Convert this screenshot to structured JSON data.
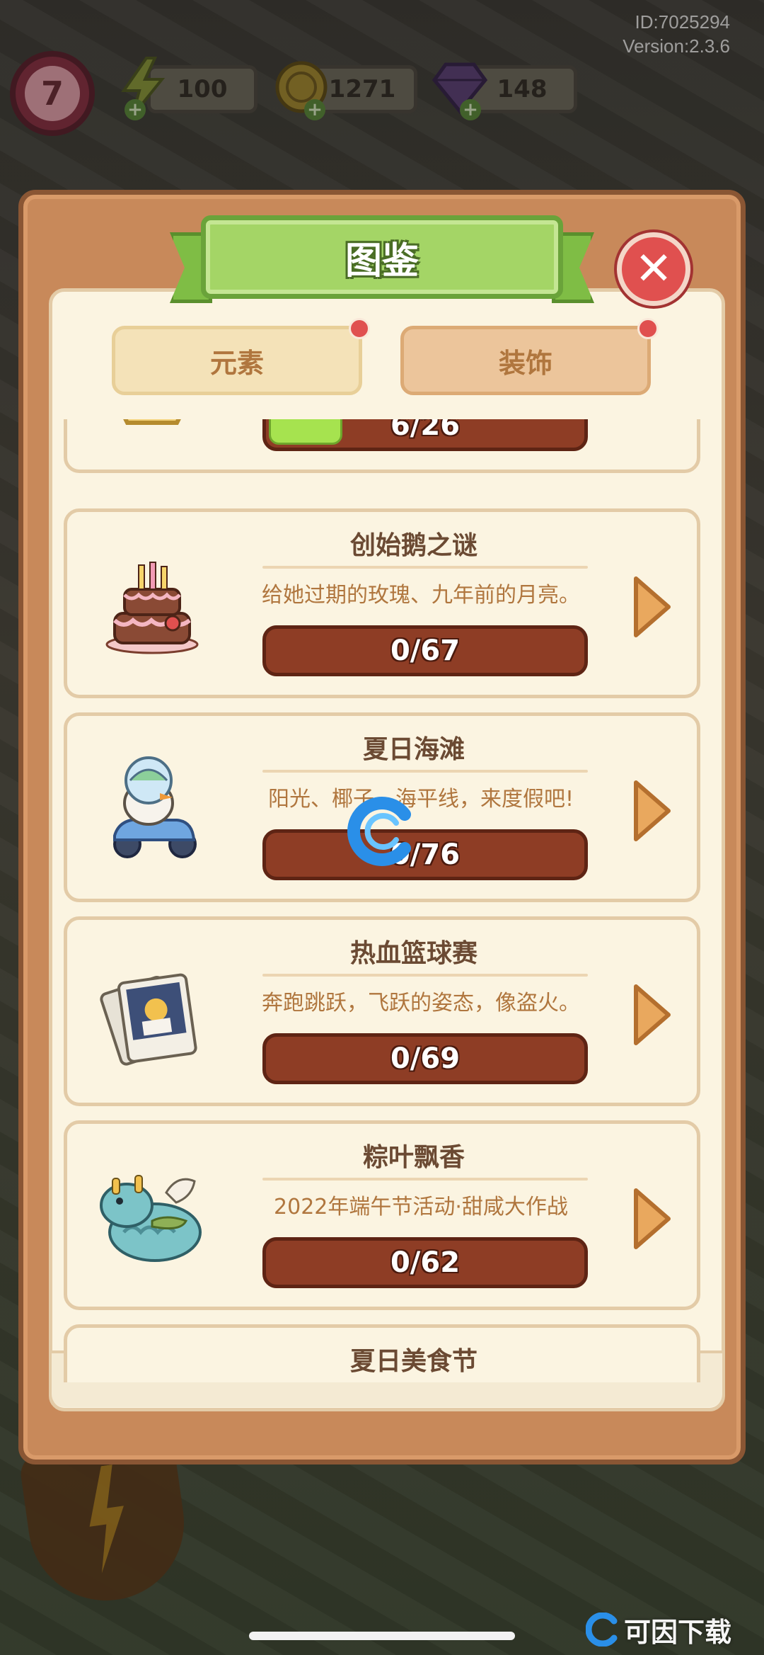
{
  "hud": {
    "id_text": "ID:7025294",
    "version_text": "Version:2.3.6",
    "level": "7",
    "energy": "100",
    "coins": "1271",
    "gems": "148"
  },
  "colors": {
    "panel_wood": "#c8895a",
    "ribbon_green": "#a4d566",
    "close_red": "#e0504f",
    "bar_brown": "#8e3d25",
    "progress_green": "#a6e34f"
  },
  "dialog": {
    "title": "图鉴",
    "close_icon": "close-icon",
    "tabs": [
      {
        "label": "元素",
        "has_notification": true
      },
      {
        "label": "装饰",
        "has_notification": true
      }
    ]
  },
  "collections": [
    {
      "title": "",
      "description": "",
      "progress_text": "6/26",
      "progress": 0.23,
      "icon": "hexagon-tile-icon"
    },
    {
      "title": "创始鹅之谜",
      "description": "给她过期的玫瑰、九年前的月亮。",
      "progress_text": "0/67",
      "progress": 0,
      "icon": "birthday-cake-icon"
    },
    {
      "title": "夏日海滩",
      "description": "阳光、椰子、海平线，来度假吧!",
      "progress_text": "0/76",
      "progress": 0,
      "icon": "goose-scooter-icon"
    },
    {
      "title": "热血篮球赛",
      "description": "奔跑跳跃，飞跃的姿态，像盗火。",
      "progress_text": "0/69",
      "progress": 0,
      "icon": "photo-cards-icon"
    },
    {
      "title": "粽叶飘香",
      "description": "2022年端午节活动·甜咸大作战",
      "progress_text": "0/62",
      "progress": 0,
      "icon": "dragon-icon"
    },
    {
      "title": "夏日美食节",
      "description": "",
      "progress_text": "",
      "progress": 0,
      "icon": "cream-bun-icon"
    }
  ],
  "watermark": {
    "text": "可因下载",
    "icon": "c-logo-icon"
  }
}
